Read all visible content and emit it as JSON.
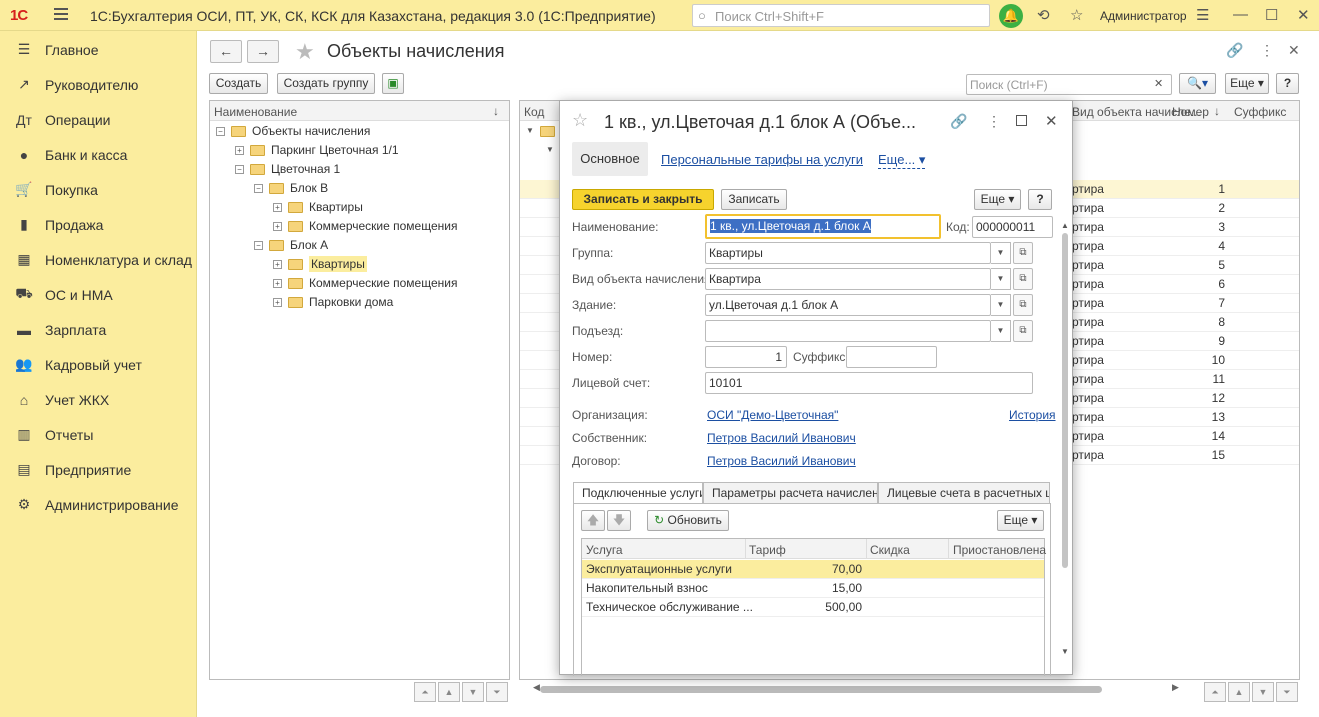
{
  "app": {
    "logo": "1С",
    "title": "1С:Бухгалтерия ОСИ, ПТ, УК, СК, КСК для Казахстана, редакция 3.0  (1С:Предприятие)",
    "search_placeholder": "Поиск Ctrl+Shift+F",
    "user": "Администратор"
  },
  "sidebar": {
    "items": [
      {
        "label": "Главное",
        "icon": "☰"
      },
      {
        "label": "Руководителю",
        "icon": "↗"
      },
      {
        "label": "Операции",
        "icon": "Дт"
      },
      {
        "label": "Банк и касса",
        "icon": "●"
      },
      {
        "label": "Покупка",
        "icon": "🛒"
      },
      {
        "label": "Продажа",
        "icon": "▮"
      },
      {
        "label": "Номенклатура и склад",
        "icon": "▦"
      },
      {
        "label": "ОС и НМА",
        "icon": "⛟"
      },
      {
        "label": "Зарплата",
        "icon": "▬"
      },
      {
        "label": "Кадровый учет",
        "icon": "👥"
      },
      {
        "label": "Учет ЖКХ",
        "icon": "⌂"
      },
      {
        "label": "Отчеты",
        "icon": "▥"
      },
      {
        "label": "Предприятие",
        "icon": "▤"
      },
      {
        "label": "Администрирование",
        "icon": "⚙"
      }
    ]
  },
  "main": {
    "title": "Объекты начисления",
    "create_label": "Создать",
    "create_group_label": "Создать группу",
    "search_placeholder": "Поиск (Ctrl+F)",
    "more_label": "Еще",
    "help_label": "?",
    "tree_header": "Наименование",
    "tree_sort": "↓",
    "tree": [
      {
        "label": "Объекты начисления",
        "level": 0,
        "expander": "−"
      },
      {
        "label": "Паркинг Цветочная 1/1",
        "level": 1,
        "expander": "+"
      },
      {
        "label": "Цветочная 1",
        "level": 1,
        "expander": "−"
      },
      {
        "label": "Блок В",
        "level": 2,
        "expander": "−"
      },
      {
        "label": "Квартиры",
        "level": 3,
        "expander": "+"
      },
      {
        "label": "Коммерческие помещения",
        "level": 3,
        "expander": "+"
      },
      {
        "label": "Блок А",
        "level": 2,
        "expander": "−"
      },
      {
        "label": "Квартиры",
        "level": 3,
        "expander": "+",
        "selected": true
      },
      {
        "label": "Коммерческие помещения",
        "level": 3,
        "expander": "+"
      },
      {
        "label": "Парковки дома",
        "level": 3,
        "expander": "+"
      }
    ],
    "list_columns": {
      "code": "Код",
      "type": "Вид объекта начисле...",
      "number": "Номер",
      "number_sort": "↓",
      "suffix": "Суффикс"
    },
    "list_rows": [
      {
        "type": "ртира",
        "number": "1"
      },
      {
        "type": "ртира",
        "number": "2"
      },
      {
        "type": "ртира",
        "number": "3"
      },
      {
        "type": "ртира",
        "number": "4"
      },
      {
        "type": "ртира",
        "number": "5"
      },
      {
        "type": "ртира",
        "number": "6"
      },
      {
        "type": "ртира",
        "number": "7"
      },
      {
        "type": "ртира",
        "number": "8"
      },
      {
        "type": "ртира",
        "number": "9"
      },
      {
        "type": "ртира",
        "number": "10"
      },
      {
        "type": "ртира",
        "number": "11"
      },
      {
        "type": "ртира",
        "number": "12"
      },
      {
        "type": "ртира",
        "number": "13"
      },
      {
        "type": "ртира",
        "number": "14"
      },
      {
        "type": "ртира",
        "number": "15"
      }
    ]
  },
  "modal": {
    "title": "1 кв., ул.Цветочая д.1 блок А (Объе...",
    "tab_main": "Основное",
    "tab_tariffs": "Персональные тарифы на услуги",
    "tab_more": "Еще...",
    "save_close": "Записать и закрыть",
    "save": "Записать",
    "more": "Еще",
    "help": "?",
    "name_label": "Наименование:",
    "name_value": "1 кв., ул.Цветочая д.1 блок А",
    "code_label": "Код:",
    "code_value": "000000011",
    "group_label": "Группа:",
    "group_value": "Квартиры",
    "kind_label": "Вид объекта начисления:",
    "kind_value": "Квартира",
    "building_label": "Здание:",
    "building_value": "ул.Цветочая д.1 блок А",
    "entrance_label": "Подъезд:",
    "entrance_value": "",
    "number_label": "Номер:",
    "number_value": "1",
    "suffix_label": "Суффикс:",
    "suffix_value": "",
    "account_label": "Лицевой счет:",
    "account_value": "10101",
    "org_label": "Организация:",
    "org_value": "ОСИ \"Демо-Цветочная\"",
    "history": "История",
    "owner_label": "Собственник:",
    "owner_value": "Петров Василий Иванович",
    "contract_label": "Договор:",
    "contract_value": "Петров Василий Иванович",
    "subtabs": [
      "Подключенные услуги",
      "Параметры расчета начислен...",
      "Лицевые счета в расчетных ц..."
    ],
    "refresh": "Обновить",
    "services_columns": [
      "Услуга",
      "Тариф",
      "Скидка",
      "Приостановлена"
    ],
    "services": [
      {
        "service": "Эксплуатационные услуги",
        "tariff": "70,00",
        "discount": "",
        "suspended": ""
      },
      {
        "service": "Накопительный взнос",
        "tariff": "15,00",
        "discount": "",
        "suspended": ""
      },
      {
        "service": "Техническое обслуживание ...",
        "tariff": "500,00",
        "discount": "",
        "suspended": ""
      }
    ]
  }
}
